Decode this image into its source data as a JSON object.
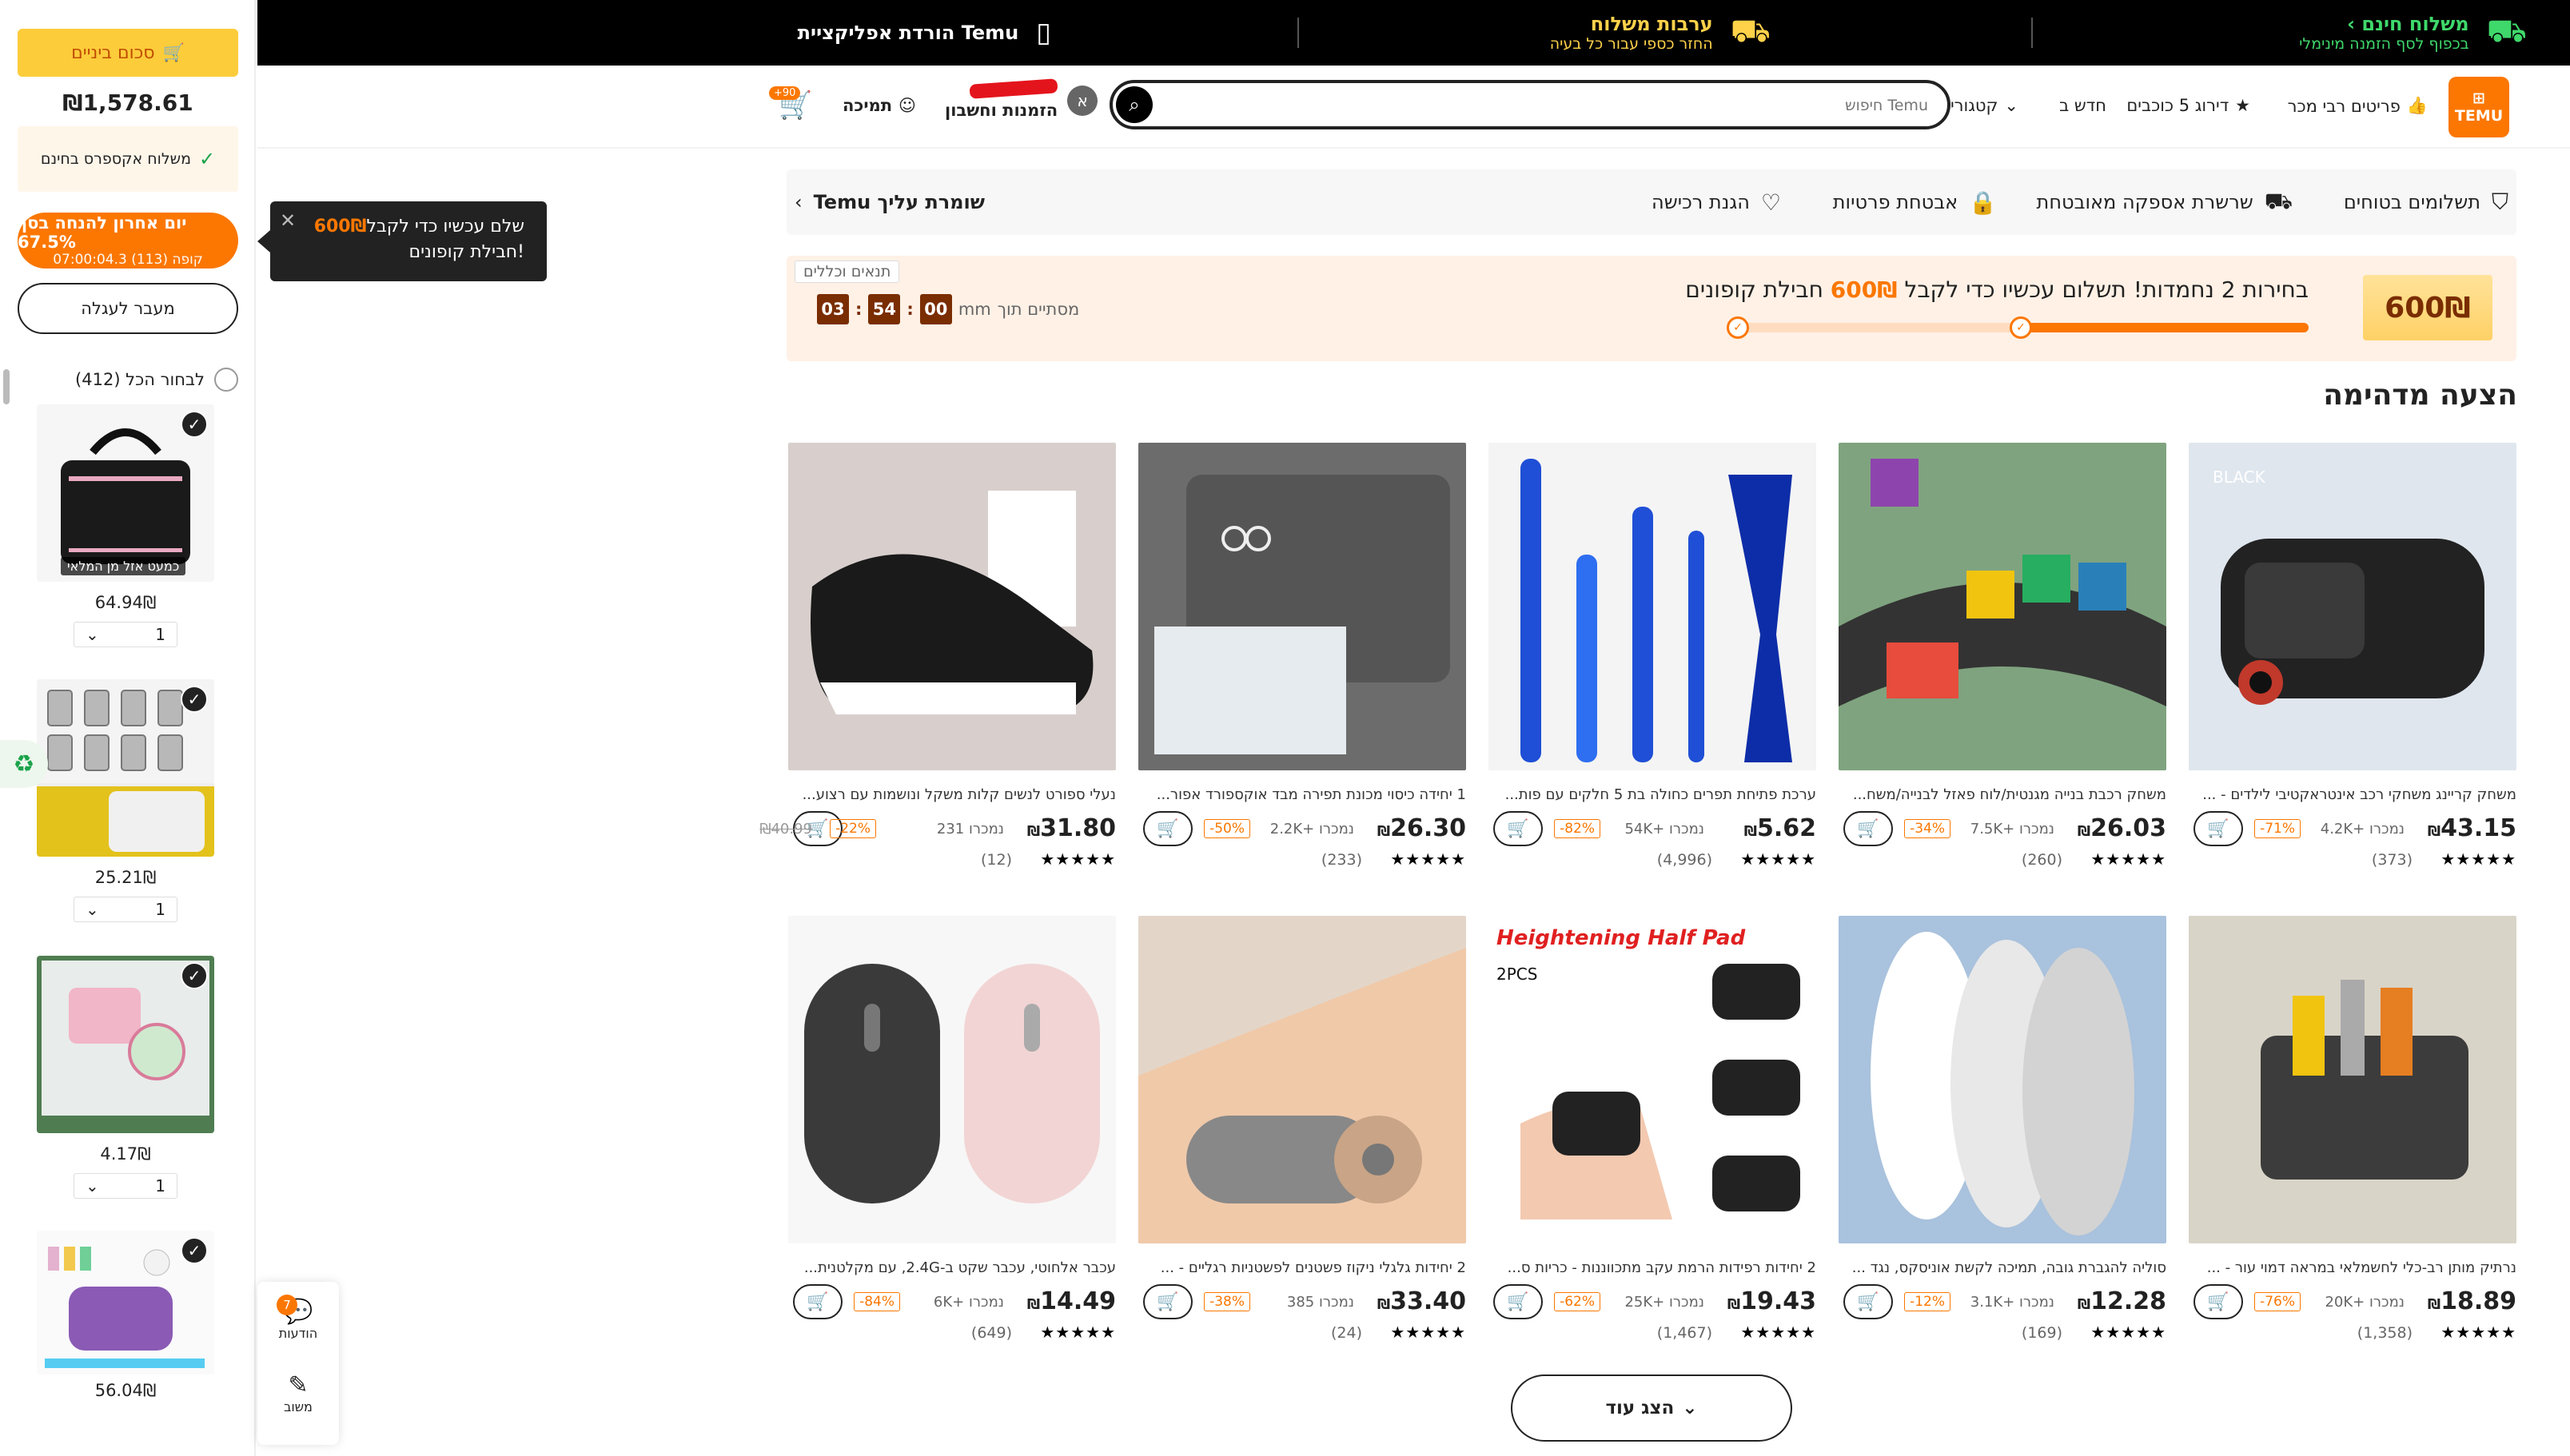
{
  "sidebar": {
    "subtotal_label": "סכום ביניים",
    "total": "₪1,578.61",
    "express_label": "משלוח אקספרס בחינם",
    "promo_line1": "יום אחרון להנחה בסך 67.5%",
    "promo_line2": "קופה (113) 07:00:04.3",
    "go_to_cart": "מעבר לעגלה",
    "select_all": "לבחור הכל (412)",
    "items": [
      {
        "price": "64.94₪",
        "qty": "1",
        "tag": "כמעט אזל מן המלאי"
      },
      {
        "price": "25.21₪",
        "qty": "1"
      },
      {
        "price": "4.17₪",
        "qty": "1"
      },
      {
        "price": "56.04₪"
      }
    ]
  },
  "tooltip": {
    "prefix": "שלם עכשיו כדי לקבל",
    "amount": "600₪",
    "suffix": "חבילת קופונים!"
  },
  "float": {
    "notifications_label": "הודעות",
    "notifications_count": "7",
    "feedback_label": "משוב"
  },
  "topbar": {
    "free_shipping_title": "משלוח חינם",
    "free_shipping_sub": "בכפוף לסף הזמנה מינימלי",
    "guarantee_title": "ערבות משלוח",
    "guarantee_sub": "החזר כספי עבור כל בעיה",
    "app_title": "הורדת אפליקציית Temu"
  },
  "header": {
    "logo": "TEMU",
    "nav": [
      "פריטים רבי מכר",
      "דירוג 5 כוכבים",
      "חדש ב",
      "קטגוריה"
    ],
    "search_placeholder": "חיפוש Temu",
    "account_initial": "א",
    "account_line2": "הזמנות וחשבון",
    "support": "תמיכה",
    "cart_badge": "+90"
  },
  "trust": {
    "items": [
      "תשלומים בטוחים",
      "שרשרת אספקה מאובטחת",
      "אבטחת פרטיות",
      "הגנת רכישה"
    ],
    "temu_label": "Temu שומרת עליך"
  },
  "banner": {
    "coupon": "600₪",
    "title_prefix": "בחירות 2 נחמדות! תשלום עכשיו כדי לקבל",
    "title_amount": "600₪",
    "title_suffix": "חבילת קופונים",
    "progress_fraction": 0.5,
    "terms": "תנאים וכללים",
    "countdown_label": "מסתיים תוך",
    "countdown_ms": "mm",
    "countdown": [
      "00",
      "54",
      "03"
    ]
  },
  "section_title": "הצעה מדהימה",
  "products": [
    {
      "title": "משחק קריינג משחקי רכב אינטראקטיבי לילדים - ...",
      "price": "43.15",
      "sold": "4.2K+ נמכרו",
      "disc": "-71%",
      "rating": "(373)"
    },
    {
      "title": "משחק רכבת בנייה מגנטית/לוח פאזל לבנייה/משח...",
      "price": "26.03",
      "sold": "7.5K+ נמכרו",
      "disc": "-34%",
      "rating": "(260)"
    },
    {
      "title": "ערכת פתיחת תפרים כחולה בת 5 חלקים עם פות...",
      "price": "5.62",
      "sold": "54K+ נמכרו",
      "disc": "-82%",
      "rating": "(4,996)"
    },
    {
      "title": "1 יחידה כיסוי מכונת תפירה מבד אוקספורד אפור...",
      "price": "26.30",
      "sold": "2.2K+ נמכרו",
      "disc": "-50%",
      "rating": "(233)"
    },
    {
      "title": "נעלי ספורט לנשים קלות משקל ונושמות עם רצוע...",
      "price": "31.80",
      "sold": "231 נמכרו",
      "orig": "₪40.99",
      "disc": "-22%",
      "rating": "(12)"
    },
    {
      "title": "נרתיק מותן רב-כלי לחשמלאי במראה דמוי עור - ...",
      "price": "18.89",
      "sold": "20K+ נמכרו",
      "disc": "-76%",
      "rating": "(1,358)"
    },
    {
      "title": "סוליה להגברת גובה, תמיכה לקשת אוניסקס, נגד ...",
      "price": "12.28",
      "sold": "3.1K+ נמכרו",
      "disc": "-12%",
      "rating": "(169)"
    },
    {
      "title": "2 יחידות רפידות הרמת עקב מתכווננות - כריות ס...",
      "price": "19.43",
      "sold": "25K+ נמכרו",
      "disc": "-62%",
      "rating": "(1,467)"
    },
    {
      "title": "2 יחידות גלגלי ניקוז פשטנים לפשטניות רגליים - ...",
      "price": "33.40",
      "sold": "385 נמכרו",
      "disc": "-38%",
      "rating": "(24)"
    },
    {
      "title": "עכבר אלחוטי, עכבר שקט ב-2.4G, עם מקלטנית...",
      "price": "14.49",
      "sold": "6K+ נמכרו",
      "disc": "-84%",
      "rating": "(649)"
    }
  ],
  "stars": "★★★★★",
  "currency": "₪",
  "show_more": "הצג עוד",
  "colors": {
    "brand": "#fb7701",
    "topbar": "#000000",
    "green": "#3fd86b",
    "yellow": "#ffd24a"
  }
}
